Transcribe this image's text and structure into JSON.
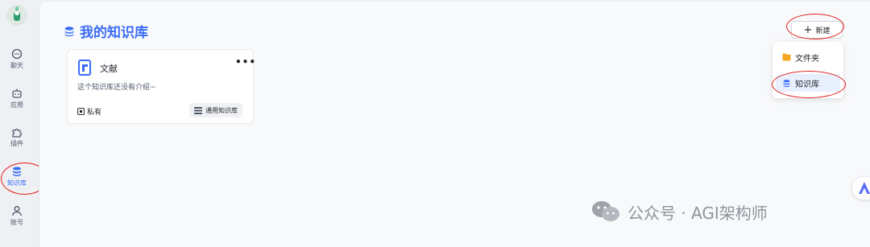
{
  "sidebar": {
    "items": [
      {
        "label": "聊天",
        "icon": "chat-icon"
      },
      {
        "label": "应用",
        "icon": "robot-icon"
      },
      {
        "label": "插件",
        "icon": "puzzle-icon"
      },
      {
        "label": "知识库",
        "icon": "database-icon",
        "active": true
      },
      {
        "label": "账号",
        "icon": "user-icon"
      }
    ]
  },
  "header": {
    "title": "我的知识库",
    "new_button_label": "新建"
  },
  "dropdown": {
    "items": [
      {
        "label": "文件夹",
        "icon": "folder-icon"
      },
      {
        "label": "知识库",
        "icon": "database-icon",
        "selected": true
      }
    ]
  },
  "card": {
    "title": "文献",
    "more": "•••",
    "description": "这个知识库还没有介绍~",
    "privacy": "私有",
    "tag": "通用知识库"
  },
  "watermark": {
    "text": "公众号 · AGI架构师"
  },
  "colors": {
    "accent": "#3b6cf6",
    "annotation_red": "#e3211c",
    "folder": "#f5a623"
  }
}
